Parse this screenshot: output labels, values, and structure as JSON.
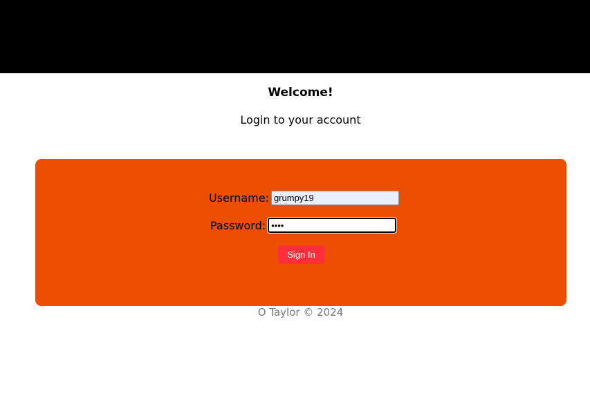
{
  "header": {
    "title": "Welcome!",
    "subtitle": "Login to your account"
  },
  "login_form": {
    "username_label": "Username:",
    "username_value": "grumpy19",
    "password_label": "Password:",
    "password_value": "••••",
    "signin_label": "Sign In"
  },
  "footer": {
    "text": "O Taylor © 2024"
  },
  "colors": {
    "top_bar": "#000000",
    "panel": "#ec4e01",
    "signin_button": "#ff2e3b",
    "username_field": "#e8f0fe",
    "footer_text": "#777777"
  }
}
